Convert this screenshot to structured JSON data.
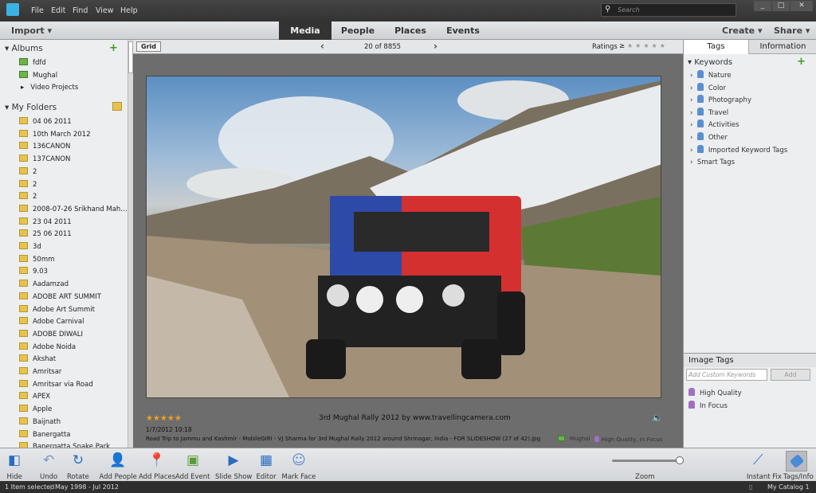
{
  "menu": [
    "File",
    "Edit",
    "Find",
    "View",
    "Help"
  ],
  "search": {
    "placeholder": "Search"
  },
  "window_controls": [
    "_",
    "□",
    "✕"
  ],
  "topbar": {
    "import": "Import",
    "tabs": [
      "Media",
      "People",
      "Places",
      "Events"
    ],
    "active_tab": "Media",
    "create": "Create",
    "share": "Share"
  },
  "albums": {
    "title": "Albums",
    "items": [
      "fdfd",
      "Mughal",
      "Video Projects"
    ]
  },
  "folders": {
    "title": "My Folders",
    "items": [
      "04 06 2011",
      "10th March 2012",
      "136CANON",
      "137CANON",
      "2",
      "2",
      "2",
      "2008-07-26 Srikhand Mah…",
      "23 04 2011",
      "25 06 2011",
      "3d",
      "50mm",
      "9.03",
      "Aadamzad",
      "ADOBE ART SUMMIT",
      "Adobe Art Summit",
      "Adobe Carnival",
      "ADOBE DIWALI",
      "Adobe Noida",
      "Akshat",
      "Amritsar",
      "Amritsar via Road",
      "APEX",
      "Apple",
      "Baijnath",
      "Banergatta",
      "Banergatta Snake Park"
    ]
  },
  "viewer": {
    "grid": "Grid",
    "counter": "20 of 8855",
    "ratings_label": "Ratings",
    "ratings_op": "≥",
    "caption": "3rd Mughal Rally 2012 by www.travellingcamera.com",
    "rating": 5,
    "date": "1/7/2012 10:18",
    "filename": "Road Trip to Jammu and Kashmir - MobileGIRI - VJ Sharma for 3rd Mughal Rally 2012 around Shrinagar, India - FOR SLIDESHOW (27 of 42).jpg",
    "album_tag": "Mughal",
    "keyword_tags": "High Quality, In Focus"
  },
  "right": {
    "tabs": [
      "Tags",
      "Information"
    ],
    "keywords_title": "Keywords",
    "keywords": [
      "Nature",
      "Color",
      "Photography",
      "Travel",
      "Activities",
      "Other",
      "Imported Keyword Tags"
    ],
    "smart_tags": "Smart Tags",
    "image_tags_title": "Image Tags",
    "custom_placeholder": "Add Custom Keywords",
    "add": "Add",
    "image_tags": [
      "High Quality",
      "In Focus"
    ]
  },
  "toolbar": [
    "Hide",
    "Undo",
    "Rotate",
    "Add People",
    "Add Places",
    "Add Event",
    "Slide Show",
    "Editor",
    "Mark Face"
  ],
  "zoom": {
    "label": "Zoom",
    "value": 1.0
  },
  "right_tools": [
    "Instant Fix",
    "Tags/Info"
  ],
  "status": {
    "selected": "1 Item selected",
    "range": "May 1998 - Jul 2012",
    "catalog": "My Catalog 1"
  },
  "colors": {
    "accent": "#3bb2e3",
    "star": "#f0a020",
    "dark": "#333333"
  }
}
